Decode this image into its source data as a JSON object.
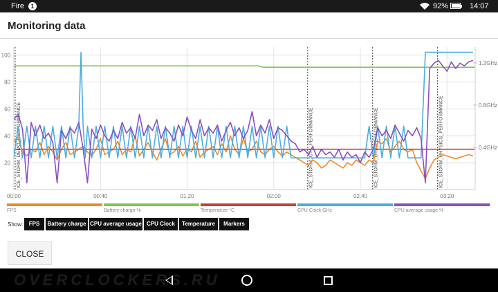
{
  "status_bar": {
    "carrier": "Fire",
    "notification_count": "1",
    "battery_percent": "92%",
    "battery_level": 0.92,
    "time": "14:07"
  },
  "dialog": {
    "title": "Monitoring data",
    "close_label": "CLOSE"
  },
  "legend": [
    {
      "label": "FPS",
      "color": "#f08a2b"
    },
    {
      "label": "Battery charge %",
      "color": "#7dc94a"
    },
    {
      "label": "Temperature °C",
      "color": "#cc3d3d"
    },
    {
      "label": "CPU Clock GHz",
      "color": "#4aaee0"
    },
    {
      "label": "CPU average usage %",
      "color": "#8a4fbf"
    }
  ],
  "show": {
    "label": "Show:",
    "toggles": [
      "FPS",
      "Battery charge",
      "CPU average usage",
      "CPU Clock",
      "Temperature",
      "Markers"
    ]
  },
  "watermark": "OVERCLOCKERS.RU",
  "chart_data": {
    "type": "line",
    "x_unit": "minutes",
    "x_ticks": [
      "00:00",
      "00:40",
      "01:20",
      "02:00",
      "02:40",
      "03:20"
    ],
    "y_left_ticks": [
      20,
      40,
      60,
      80,
      100
    ],
    "y_right_ticks": [
      "0.4GHz",
      "0.8GHz",
      "1.2GHz"
    ],
    "xlim": [
      0,
      213
    ],
    "ylim_left": [
      0,
      106
    ],
    "ylim_right_ghz": [
      0,
      1.35
    ],
    "grid": true,
    "markers": [
      {
        "label": "ICE_STORM_DEMO_PERFORMANCE",
        "x": 0
      },
      {
        "label": "ICE_STORM_GT1_PERFORMANCE",
        "x": 135
      },
      {
        "label": "ICE_STORM_GT2_PERFORMANCE",
        "x": 165
      },
      {
        "label": "ICE_STORM_PHYSICS_PERFORMANCE",
        "x": 195
      }
    ],
    "series": [
      {
        "name": "FPS",
        "color": "#f08a2b",
        "axis": "left",
        "x": [
          0,
          2,
          4,
          6,
          8,
          10,
          12,
          14,
          16,
          18,
          20,
          22,
          24,
          26,
          28,
          30,
          32,
          34,
          36,
          38,
          40,
          42,
          44,
          46,
          48,
          50,
          52,
          54,
          56,
          58,
          60,
          62,
          64,
          66,
          68,
          70,
          72,
          74,
          76,
          78,
          80,
          82,
          84,
          86,
          88,
          90,
          92,
          94,
          96,
          98,
          100,
          102,
          104,
          106,
          108,
          110,
          112,
          114,
          116,
          118,
          120,
          122,
          124,
          126,
          128,
          130,
          132,
          134,
          136,
          138,
          140,
          142,
          144,
          146,
          148,
          150,
          152,
          154,
          156,
          158,
          160,
          162,
          164,
          166,
          168,
          170,
          172,
          174,
          176,
          178,
          180,
          182,
          184,
          186,
          188,
          190,
          192,
          194,
          196,
          198,
          200,
          202,
          204,
          206,
          208,
          210,
          212
        ],
        "values": [
          36,
          38,
          28,
          25,
          30,
          28,
          35,
          26,
          32,
          28,
          22,
          30,
          35,
          26,
          28,
          30,
          32,
          28,
          25,
          30,
          38,
          26,
          28,
          30,
          36,
          26,
          30,
          28,
          40,
          25,
          30,
          35,
          28,
          22,
          30,
          38,
          26,
          28,
          32,
          25,
          30,
          28,
          36,
          24,
          28,
          30,
          32,
          26,
          34,
          28,
          40,
          30,
          26,
          38,
          28,
          30,
          36,
          28,
          26,
          30,
          32,
          28,
          25,
          28,
          26,
          24,
          22,
          20,
          18,
          22,
          20,
          16,
          18,
          22,
          20,
          18,
          16,
          20,
          18,
          22,
          20,
          18,
          22,
          20,
          36,
          34,
          38,
          28,
          32,
          36,
          30,
          28,
          30,
          20,
          14,
          8,
          16,
          22,
          24,
          26,
          25,
          24,
          23,
          24,
          25,
          26,
          25
        ]
      },
      {
        "name": "Battery charge %",
        "color": "#7dc94a",
        "axis": "left",
        "x": [
          0,
          113,
          115,
          213
        ],
        "values": [
          92,
          92,
          91,
          91
        ]
      },
      {
        "name": "Temperature °C",
        "color": "#cc3d3d",
        "axis": "left",
        "x": [
          0,
          213
        ],
        "values": [
          30,
          30
        ]
      },
      {
        "name": "CPU Clock GHz",
        "color": "#4aaee0",
        "axis": "right",
        "x": [
          0,
          2,
          4,
          6,
          8,
          10,
          12,
          14,
          16,
          18,
          20,
          22,
          24,
          26,
          28,
          30,
          31,
          32,
          33,
          34,
          36,
          38,
          40,
          42,
          44,
          46,
          48,
          50,
          52,
          54,
          56,
          58,
          60,
          62,
          64,
          66,
          68,
          70,
          72,
          74,
          76,
          78,
          80,
          82,
          84,
          86,
          88,
          90,
          92,
          94,
          96,
          98,
          100,
          102,
          104,
          106,
          108,
          110,
          112,
          114,
          116,
          118,
          120,
          122,
          124,
          126,
          128,
          130,
          132,
          134,
          136,
          138,
          140,
          142,
          144,
          146,
          148,
          150,
          152,
          154,
          156,
          158,
          160,
          162,
          164,
          166,
          168,
          170,
          172,
          174,
          176,
          178,
          180,
          182,
          184,
          186,
          188,
          190,
          192,
          194,
          196,
          197,
          198,
          200,
          202,
          204,
          206,
          208,
          210,
          212
        ],
        "values": [
          0.3,
          0.6,
          0.3,
          0.6,
          0.3,
          0.6,
          0.3,
          0.6,
          0.3,
          0.6,
          0.3,
          0.6,
          0.3,
          0.6,
          0.3,
          0.6,
          1.3,
          0.6,
          0.3,
          0.6,
          0.3,
          0.6,
          0.3,
          0.6,
          0.3,
          0.6,
          0.3,
          0.6,
          0.3,
          0.6,
          0.3,
          0.6,
          0.3,
          0.6,
          0.3,
          0.6,
          0.3,
          0.6,
          0.3,
          0.6,
          0.3,
          0.6,
          0.3,
          0.6,
          0.3,
          0.6,
          0.3,
          0.6,
          0.3,
          0.6,
          0.3,
          0.6,
          0.3,
          0.6,
          0.3,
          0.6,
          0.3,
          0.6,
          0.3,
          0.6,
          0.3,
          0.6,
          0.3,
          0.6,
          0.3,
          0.6,
          0.3,
          0.3,
          0.3,
          0.3,
          0.3,
          0.3,
          0.3,
          0.3,
          0.3,
          0.3,
          0.3,
          0.3,
          0.3,
          0.3,
          0.3,
          0.3,
          0.3,
          0.3,
          0.6,
          0.3,
          0.6,
          0.3,
          0.6,
          0.3,
          0.6,
          0.3,
          0.6,
          0.3,
          0.3,
          0.3,
          0.3,
          1.3,
          1.3,
          1.3,
          1.3,
          1.3,
          1.3,
          1.3,
          1.3,
          1.3,
          1.3,
          1.3,
          1.3,
          1.3
        ]
      },
      {
        "name": "CPU average usage %",
        "color": "#8a4fbf",
        "axis": "left",
        "x": [
          0,
          2,
          4,
          6,
          8,
          10,
          12,
          14,
          16,
          18,
          20,
          22,
          24,
          26,
          28,
          30,
          32,
          34,
          36,
          38,
          40,
          42,
          44,
          46,
          48,
          50,
          52,
          54,
          56,
          58,
          60,
          62,
          64,
          66,
          68,
          70,
          72,
          74,
          76,
          78,
          80,
          82,
          84,
          86,
          88,
          90,
          92,
          94,
          96,
          98,
          100,
          102,
          104,
          106,
          108,
          110,
          112,
          114,
          116,
          118,
          120,
          122,
          124,
          126,
          128,
          130,
          132,
          134,
          136,
          138,
          140,
          142,
          144,
          146,
          148,
          150,
          152,
          154,
          156,
          158,
          160,
          162,
          164,
          166,
          168,
          170,
          172,
          174,
          176,
          178,
          180,
          182,
          184,
          186,
          188,
          190,
          192,
          194,
          196,
          198,
          200,
          202,
          204,
          206,
          208,
          210,
          212
        ],
        "values": [
          52,
          56,
          45,
          5,
          50,
          40,
          48,
          38,
          42,
          35,
          5,
          44,
          38,
          46,
          42,
          50,
          30,
          5,
          45,
          38,
          48,
          40,
          36,
          44,
          38,
          50,
          42,
          46,
          38,
          56,
          40,
          48,
          44,
          52,
          38,
          46,
          42,
          36,
          48,
          40,
          54,
          44,
          38,
          52,
          40,
          46,
          42,
          48,
          36,
          44,
          50,
          40,
          46,
          38,
          44,
          58,
          40,
          48,
          42,
          52,
          38,
          46,
          44,
          40,
          36,
          34,
          28,
          30,
          26,
          32,
          24,
          30,
          26,
          28,
          24,
          30,
          22,
          28,
          24,
          26,
          20,
          28,
          24,
          30,
          46,
          40,
          44,
          38,
          48,
          42,
          36,
          44,
          40,
          46,
          38,
          5,
          90,
          94,
          96,
          92,
          88,
          95,
          90,
          94,
          92,
          95,
          96
        ]
      }
    ]
  }
}
